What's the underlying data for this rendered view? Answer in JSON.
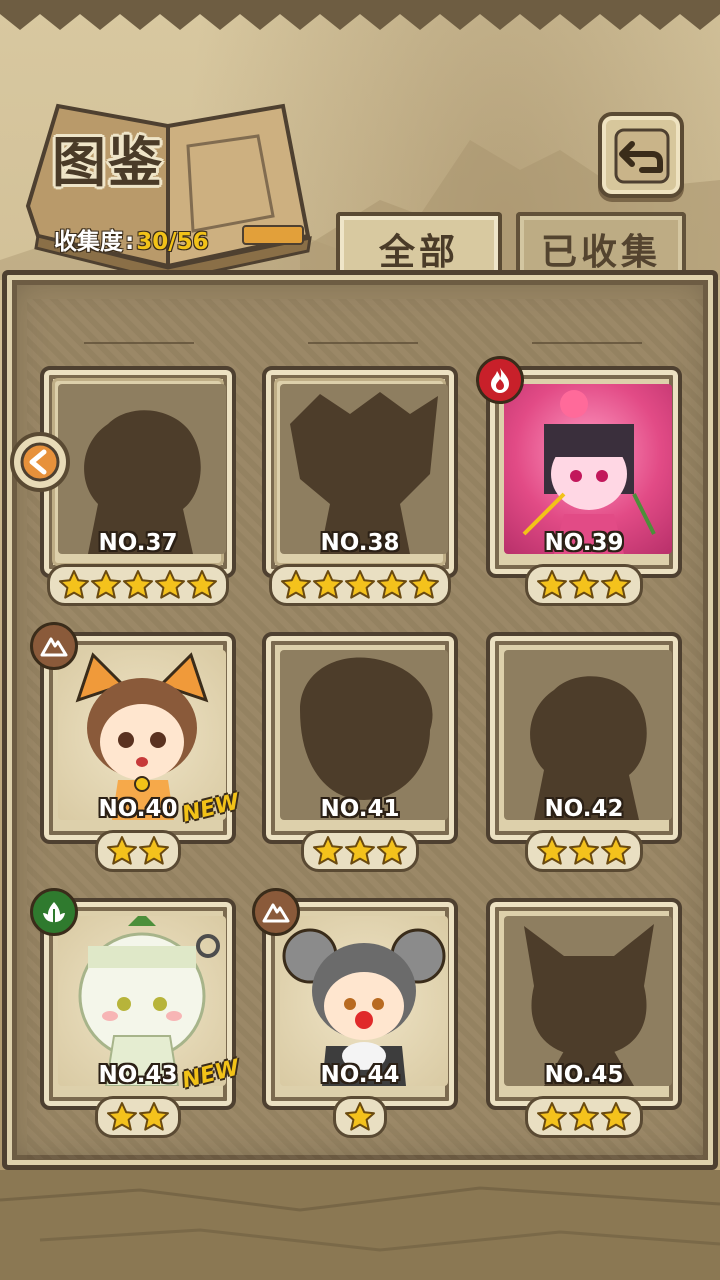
{
  "header": {
    "title": "图鉴",
    "progress_label": "收集度",
    "progress_value": "30/56"
  },
  "tabs": [
    {
      "label": "全部",
      "active": true
    },
    {
      "label": "已收集",
      "active": false
    }
  ],
  "colors": {
    "accent_gold": "#f2c218",
    "frame_dark": "#4e4030",
    "parchment": "#d8c8a0",
    "fire": "#c8202a",
    "earth": "#8a5a3a",
    "leaf": "#2f7a2e"
  },
  "cards": [
    {
      "number": "NO.37",
      "stars": 5,
      "unlocked": false,
      "element": null,
      "new": false,
      "new_label": ""
    },
    {
      "number": "NO.38",
      "stars": 5,
      "unlocked": false,
      "element": null,
      "new": false,
      "new_label": ""
    },
    {
      "number": "NO.39",
      "stars": 3,
      "unlocked": true,
      "element": "fire-icon",
      "new": false,
      "new_label": ""
    },
    {
      "number": "NO.40",
      "stars": 2,
      "unlocked": true,
      "element": "mountain-icon",
      "new": true,
      "new_label": "NEW"
    },
    {
      "number": "NO.41",
      "stars": 3,
      "unlocked": false,
      "element": null,
      "new": false,
      "new_label": ""
    },
    {
      "number": "NO.42",
      "stars": 3,
      "unlocked": false,
      "element": null,
      "new": false,
      "new_label": ""
    },
    {
      "number": "NO.43",
      "stars": 2,
      "unlocked": true,
      "element": "leaf-icon",
      "new": true,
      "new_label": "NEW"
    },
    {
      "number": "NO.44",
      "stars": 1,
      "unlocked": true,
      "element": "mountain-icon",
      "new": false,
      "new_label": ""
    },
    {
      "number": "NO.45",
      "stars": 3,
      "unlocked": false,
      "element": null,
      "new": false,
      "new_label": ""
    }
  ]
}
